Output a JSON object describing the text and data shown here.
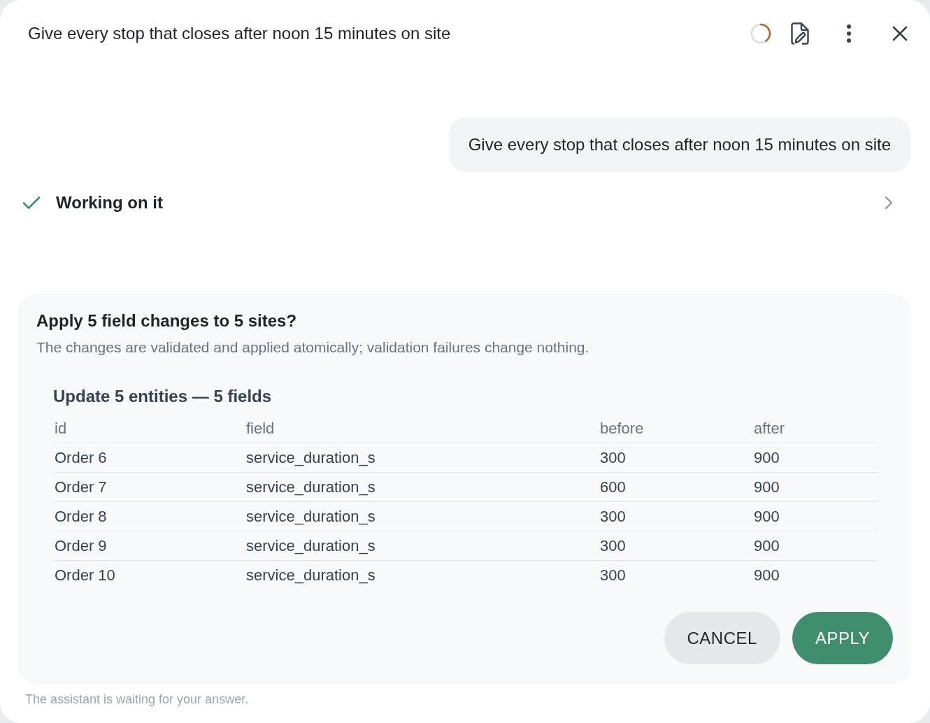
{
  "header": {
    "title": "Give every stop that closes after noon 15 minutes on site"
  },
  "user_message": {
    "text": "Give every stop that closes after noon 15 minutes on site"
  },
  "status": {
    "text": "Working on it",
    "done": true,
    "expanded": false
  },
  "confirm_card": {
    "title": "Apply 5 field changes to 5 sites?",
    "description": "The changes are validated and applied atomically; validation failures change nothing.",
    "section": {
      "title": "Update 5 entities — 5 fields",
      "columns": [
        "id",
        "field",
        "before",
        "after"
      ],
      "rows": [
        [
          "Order 6",
          "service_duration_s",
          "300",
          "900"
        ],
        [
          "Order 7",
          "service_duration_s",
          "600",
          "900"
        ],
        [
          "Order 8",
          "service_duration_s",
          "300",
          "900"
        ],
        [
          "Order 9",
          "service_duration_s",
          "300",
          "900"
        ],
        [
          "Order 10",
          "service_duration_s",
          "300",
          "900"
        ]
      ]
    },
    "buttons": [
      {
        "label": "CANCEL",
        "kind": "secondary"
      },
      {
        "label": "APPLY",
        "kind": "primary"
      }
    ]
  },
  "footer": {
    "text": "The assistant is waiting for your answer."
  }
}
